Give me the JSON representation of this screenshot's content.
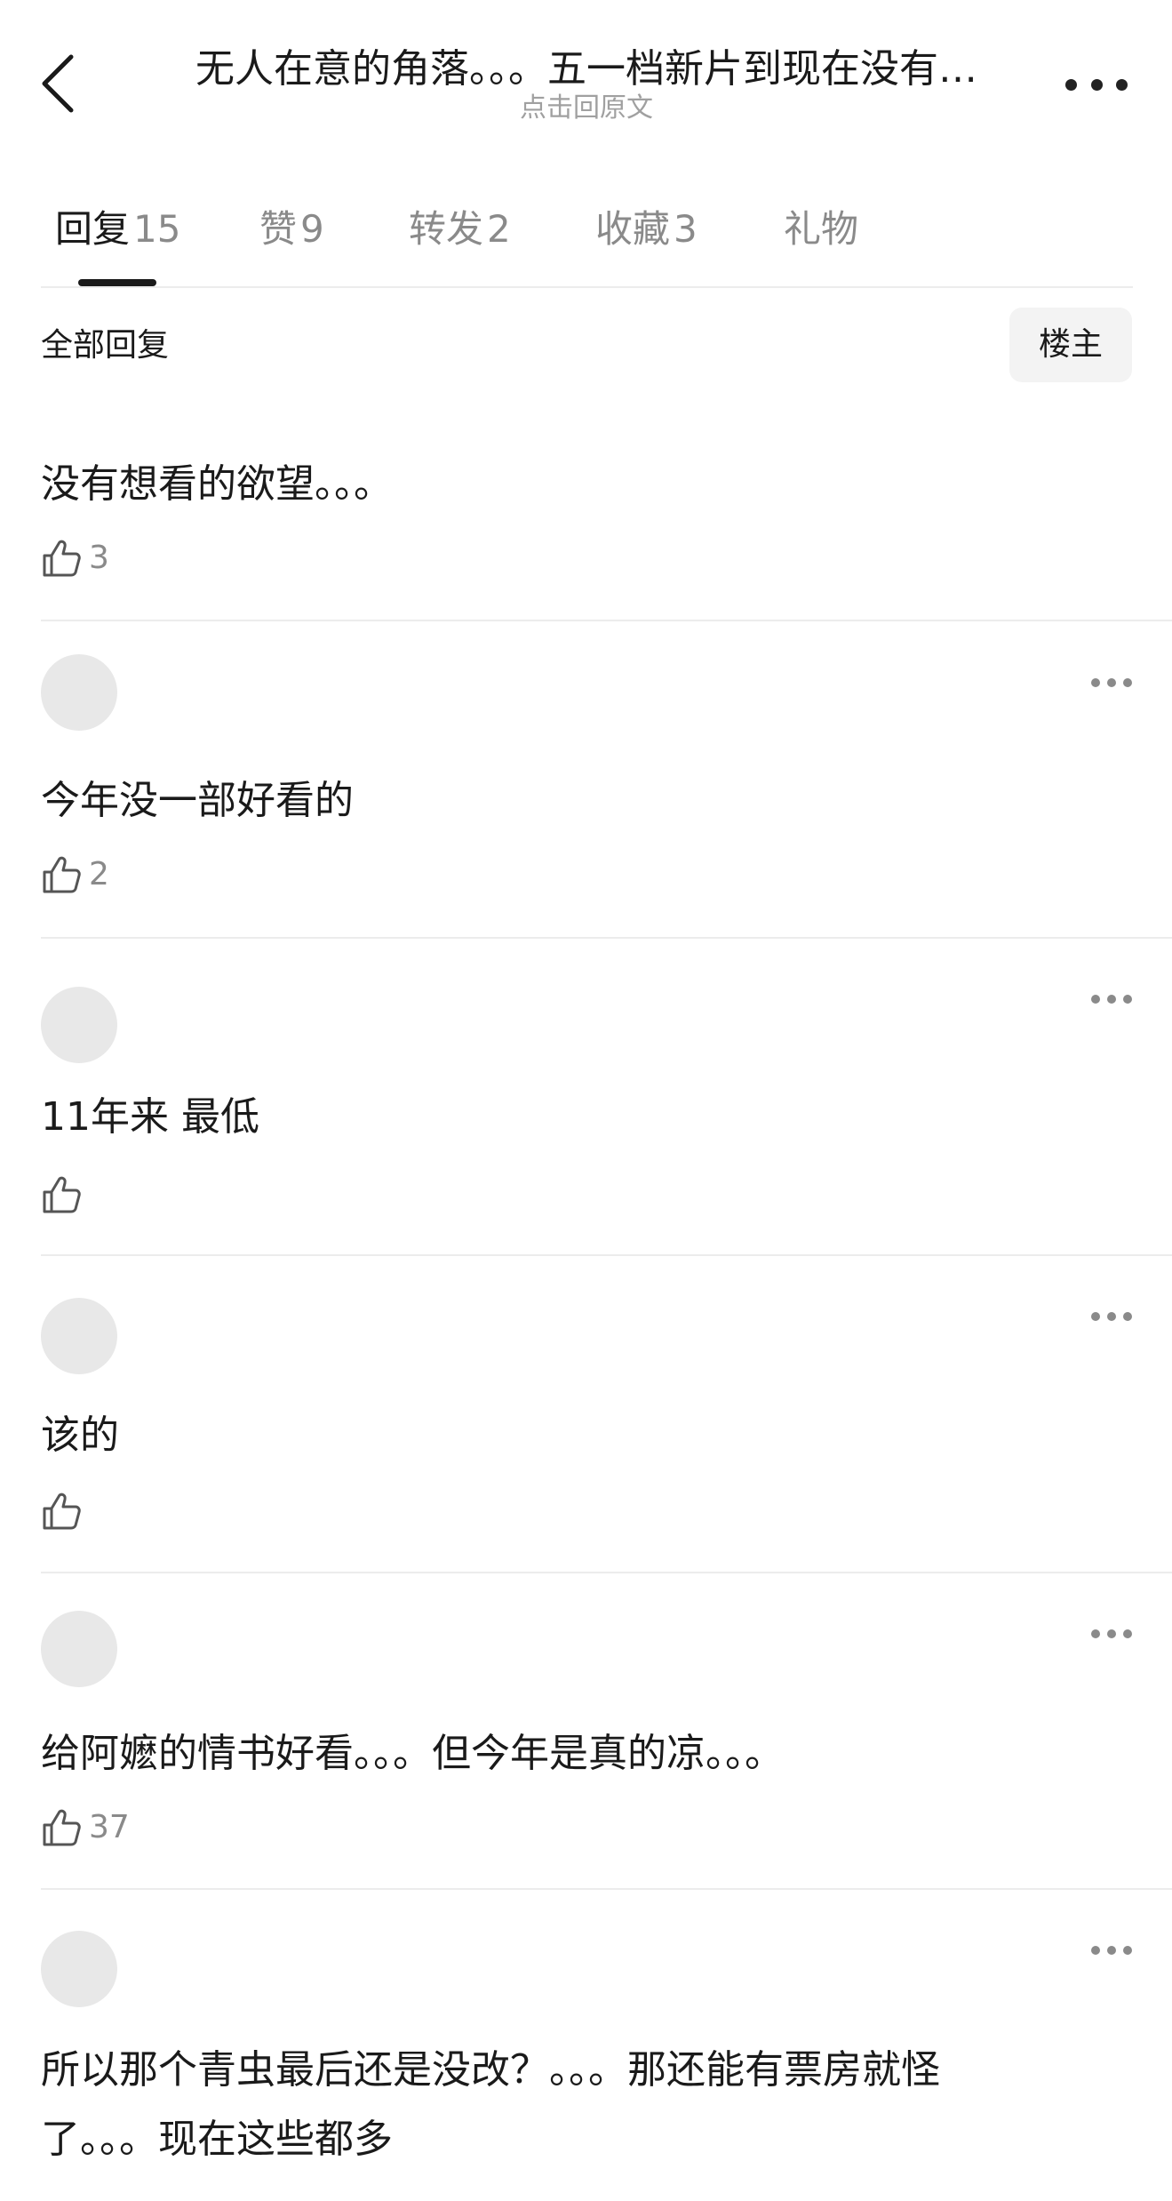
{
  "header": {
    "title": "无人在意的角落。。。五一档新片到现在没有…",
    "subtitle": "点击回原文",
    "back_icon": "chevron-left-icon",
    "more_icon": "more-horizontal-icon"
  },
  "tabs": [
    {
      "label": "回复",
      "count": "15",
      "active": true
    },
    {
      "label": "赞",
      "count": "9",
      "active": false
    },
    {
      "label": "转发",
      "count": "2",
      "active": false
    },
    {
      "label": "收藏",
      "count": "3",
      "active": false
    },
    {
      "label": "礼物",
      "count": "",
      "active": false
    }
  ],
  "filter": {
    "label": "全部回复",
    "owner_button": "楼主"
  },
  "replies": [
    {
      "text": "没有想看的欲望。。。",
      "likes": "3"
    },
    {
      "text": "今年没一部好看的",
      "likes": "2"
    },
    {
      "text": "11年来 最低",
      "likes": ""
    },
    {
      "text": "该的",
      "likes": ""
    },
    {
      "text": "给阿嬷的情书好看。。。但今年是真的凉。。。",
      "likes": "37"
    },
    {
      "text": "所以那个青虫最后还是没改？。。。那还能有票房就怪了。。。现在这些都多",
      "likes": ""
    }
  ],
  "colors": {
    "text_primary": "#1a1a1a",
    "text_secondary": "#8a8a8a",
    "divider": "#ececec",
    "button_bg": "#f3f3f3"
  }
}
